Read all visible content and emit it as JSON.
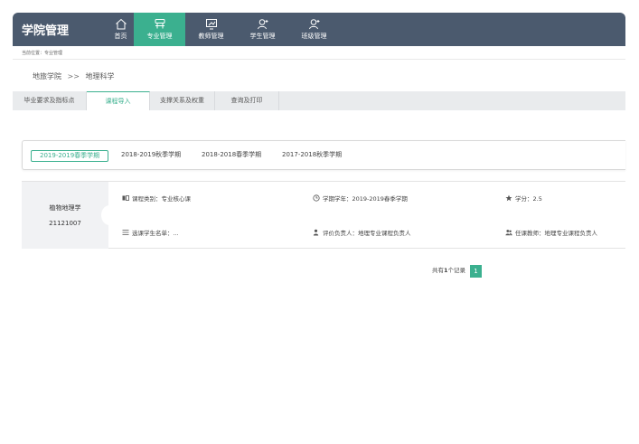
{
  "header": {
    "app_title": "学院管理",
    "nav": [
      {
        "label": "首页",
        "icon": "home-icon"
      },
      {
        "label": "专业管理",
        "icon": "major-icon"
      },
      {
        "label": "教师管理",
        "icon": "teacher-icon"
      },
      {
        "label": "学生管理",
        "icon": "student-icon"
      },
      {
        "label": "班级管理",
        "icon": "class-icon"
      }
    ],
    "colors": {
      "bar": "#4b5a6e",
      "accent": "#3bb08f"
    }
  },
  "location": {
    "text": "当前位置：专业管理"
  },
  "breadcrumb": {
    "college": "地旅学院",
    "separator": ">>",
    "major": "地理科学"
  },
  "tabs": [
    {
      "label": "毕业要求及指标点"
    },
    {
      "label": "课程导入"
    },
    {
      "label": "支撑关系及权重"
    },
    {
      "label": "查询及打印"
    }
  ],
  "terms": [
    {
      "label": "2019-2019春季学期"
    },
    {
      "label": "2018-2019秋季学期"
    },
    {
      "label": "2018-2018春季学期"
    },
    {
      "label": "2017-2018秋季学期"
    }
  ],
  "course": {
    "name": "植物地理学",
    "code": "21121007",
    "category": "课程类别：专业核心课",
    "term": "学期学年：2019-2019春季学期",
    "credit": "学分：2.5",
    "students": "选课学生名单：...",
    "evaluator": "评价负责人：地理专业课程负责人",
    "teacher": "任课教师：地理专业课程负责人"
  },
  "pagination": {
    "prefix": "共有",
    "count": "1",
    "suffix": "个记录",
    "current_page": "1"
  }
}
